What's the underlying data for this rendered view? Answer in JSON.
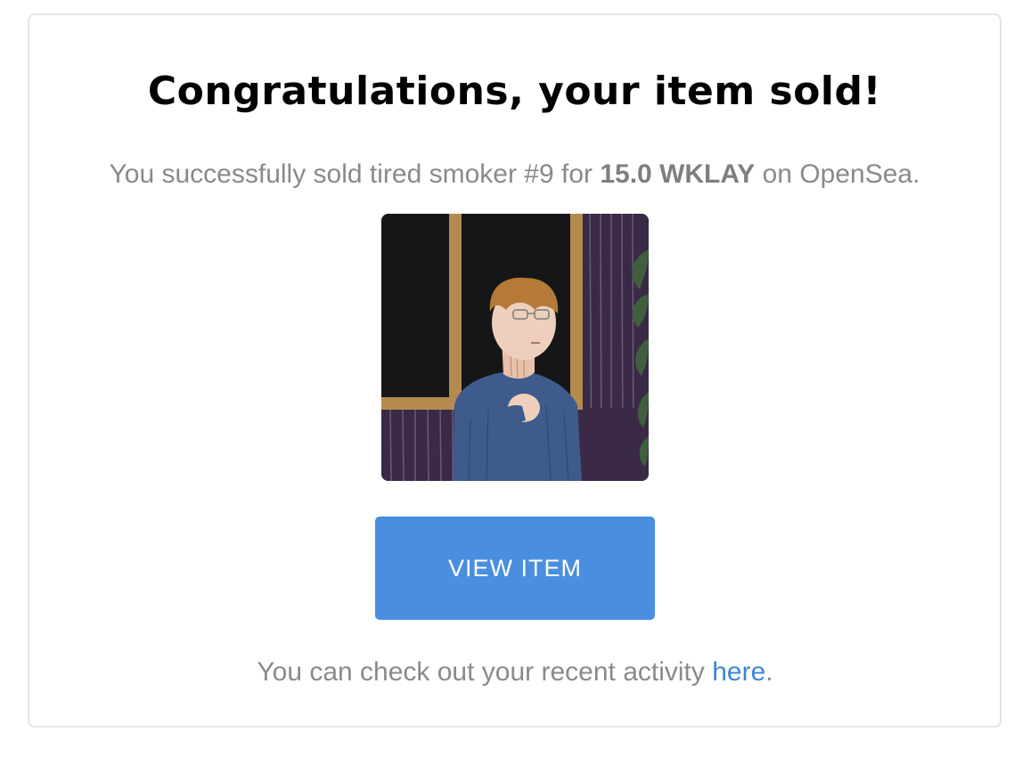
{
  "email": {
    "title": "Congratulations, your item sold!",
    "message": {
      "prefix": "You successfully sold tired smoker #9 for ",
      "amount": "15.0 WKLAY",
      "suffix": " on OpenSea."
    },
    "item_image_alt": "tired smoker #9",
    "view_button_label": "VIEW ITEM",
    "footer": {
      "prefix": "You can check out your recent activity ",
      "link_label": "here",
      "suffix": "."
    }
  },
  "colors": {
    "button": "#4a8ee0",
    "link": "#3d86d8",
    "body_text": "#8a8a8a",
    "title_text": "#000000"
  }
}
